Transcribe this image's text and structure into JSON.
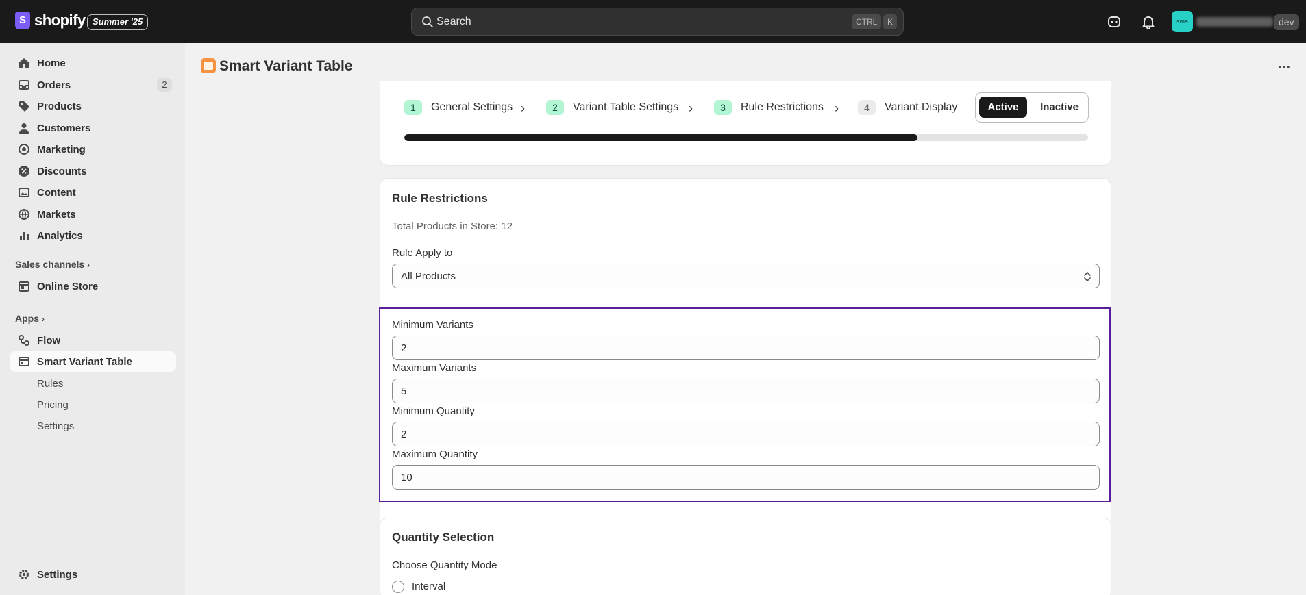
{
  "topbar": {
    "brand": "shopify",
    "edition_badge": "Summer '25",
    "search_placeholder": "Search",
    "shortcut_keys": [
      "CTRL",
      "K"
    ],
    "avatar_initials": "sma",
    "store_tag": "dev"
  },
  "sidebar": {
    "items": [
      {
        "label": "Home",
        "icon": "home-icon"
      },
      {
        "label": "Orders",
        "icon": "orders-icon",
        "count": "2"
      },
      {
        "label": "Products",
        "icon": "tag-icon"
      },
      {
        "label": "Customers",
        "icon": "person-icon"
      },
      {
        "label": "Marketing",
        "icon": "target-icon"
      },
      {
        "label": "Discounts",
        "icon": "discount-icon"
      },
      {
        "label": "Content",
        "icon": "content-icon"
      },
      {
        "label": "Markets",
        "icon": "globe-icon"
      },
      {
        "label": "Analytics",
        "icon": "bar-chart-icon"
      }
    ],
    "sales_channels_label": "Sales channels",
    "online_store_label": "Online Store",
    "apps_label": "Apps",
    "flow_label": "Flow",
    "app_label": "Smart Variant Table",
    "app_subitems": [
      "Rules",
      "Pricing",
      "Settings"
    ],
    "settings_label": "Settings"
  },
  "page": {
    "title": "Smart Variant Table"
  },
  "stepper": {
    "steps": [
      {
        "num": "1",
        "label": "General Settings",
        "state": "done"
      },
      {
        "num": "2",
        "label": "Variant Table Settings",
        "state": "done"
      },
      {
        "num": "3",
        "label": "Rule Restrictions",
        "state": "done"
      },
      {
        "num": "4",
        "label": "Variant Display",
        "state": "pending"
      }
    ],
    "toggle_active": "Active",
    "toggle_inactive": "Inactive",
    "progress_fraction": 0.75
  },
  "rule_restrictions": {
    "title": "Rule Restrictions",
    "total_products": "Total Products in Store: 12",
    "apply_label": "Rule Apply to",
    "apply_value": "All Products",
    "min_variants_label": "Minimum Variants",
    "min_variants_value": "2",
    "max_variants_label": "Maximum Variants",
    "max_variants_value": "5",
    "min_quantity_label": "Minimum Quantity",
    "min_quantity_value": "2",
    "max_quantity_label": "Maximum Quantity",
    "max_quantity_value": "10"
  },
  "quantity_selection": {
    "title": "Quantity Selection",
    "mode_label": "Choose Quantity Mode",
    "option_interval": "Interval"
  },
  "colors": {
    "topbar": "#1a1a1a",
    "highlight": "#5c1f9c",
    "step_done": "#b2f5d4",
    "avatar": "#28d1c6"
  }
}
